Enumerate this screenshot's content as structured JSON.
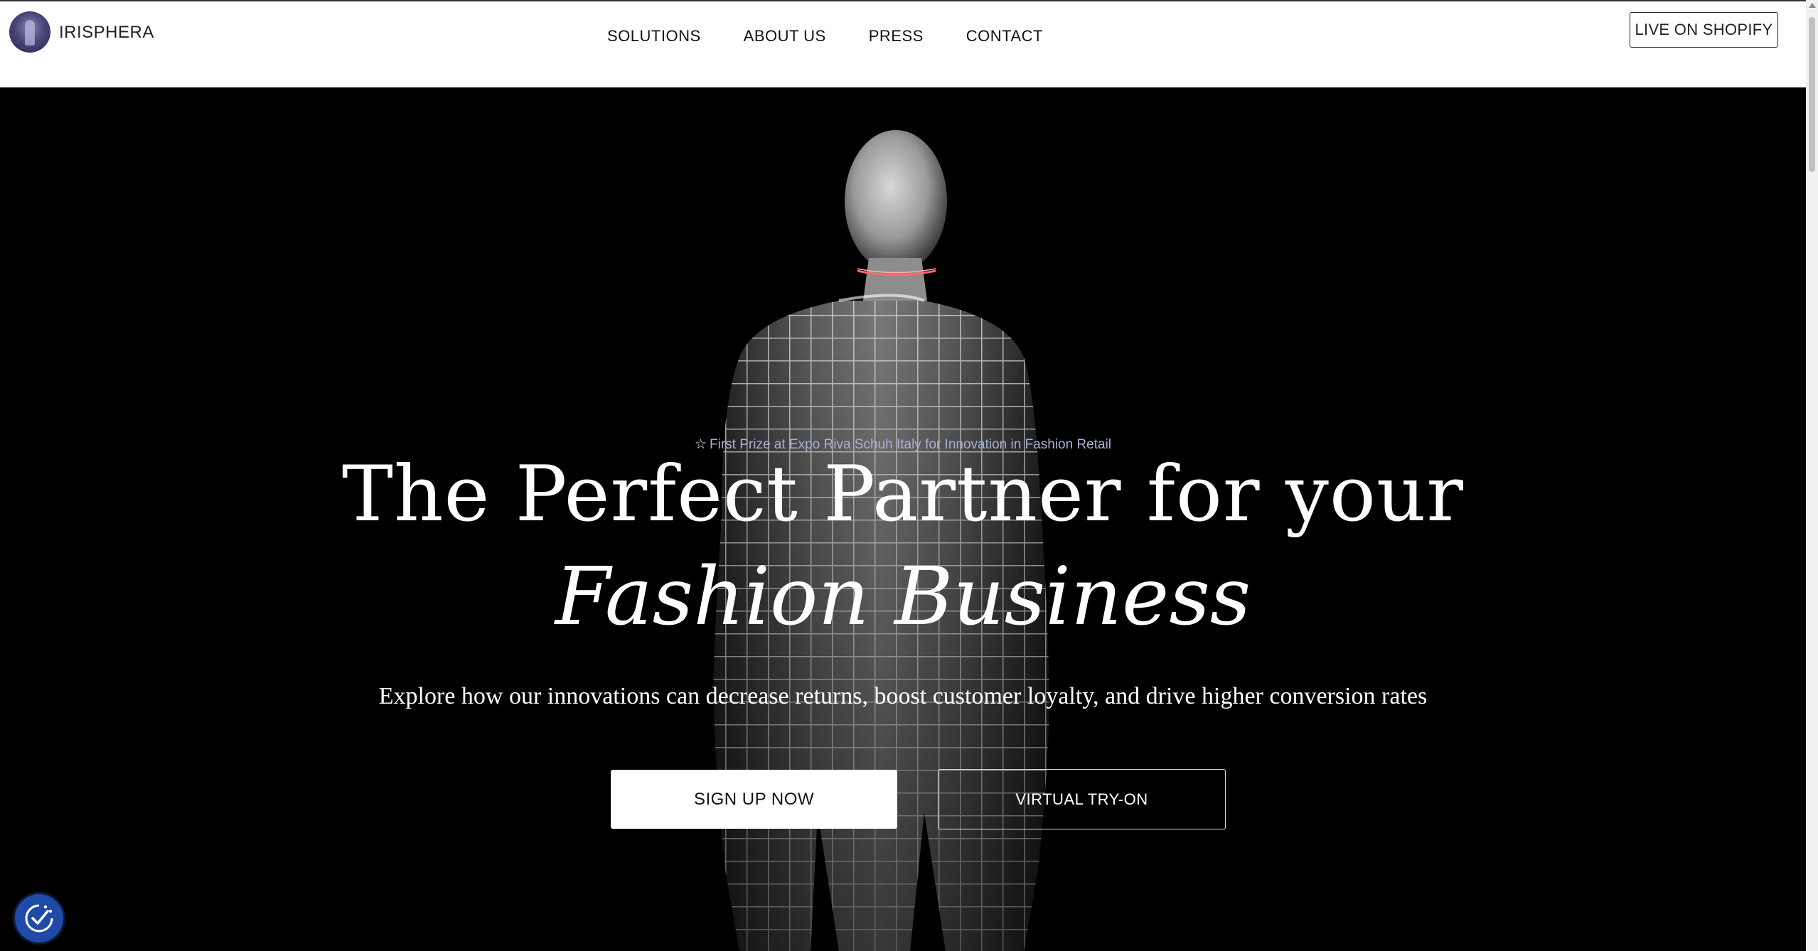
{
  "header": {
    "brand": "IRISPHERA",
    "nav": [
      "SOLUTIONS",
      "ABOUT US",
      "PRESS",
      "CONTACT"
    ],
    "cta": "LIVE ON SHOPIFY"
  },
  "hero": {
    "award": "First Prize at Expo Riva Schuh Italy for Innovation in Fashion Retail",
    "headline_line1": "The Perfect Partner for your",
    "headline_line2": "Fashion Business",
    "subtext": "Explore how our innovations can decrease returns, boost customer loyalty, and drive higher conversion rates",
    "primary_button": "SIGN UP NOW",
    "secondary_button": "VIRTUAL TRY-ON"
  },
  "icons": {
    "award": "star-outline-icon",
    "consent": "cookie-consent-check-icon"
  },
  "colors": {
    "hero_bg": "#000000",
    "award_text": "#a9b0d6",
    "consent_button": "#1f4aa8"
  }
}
